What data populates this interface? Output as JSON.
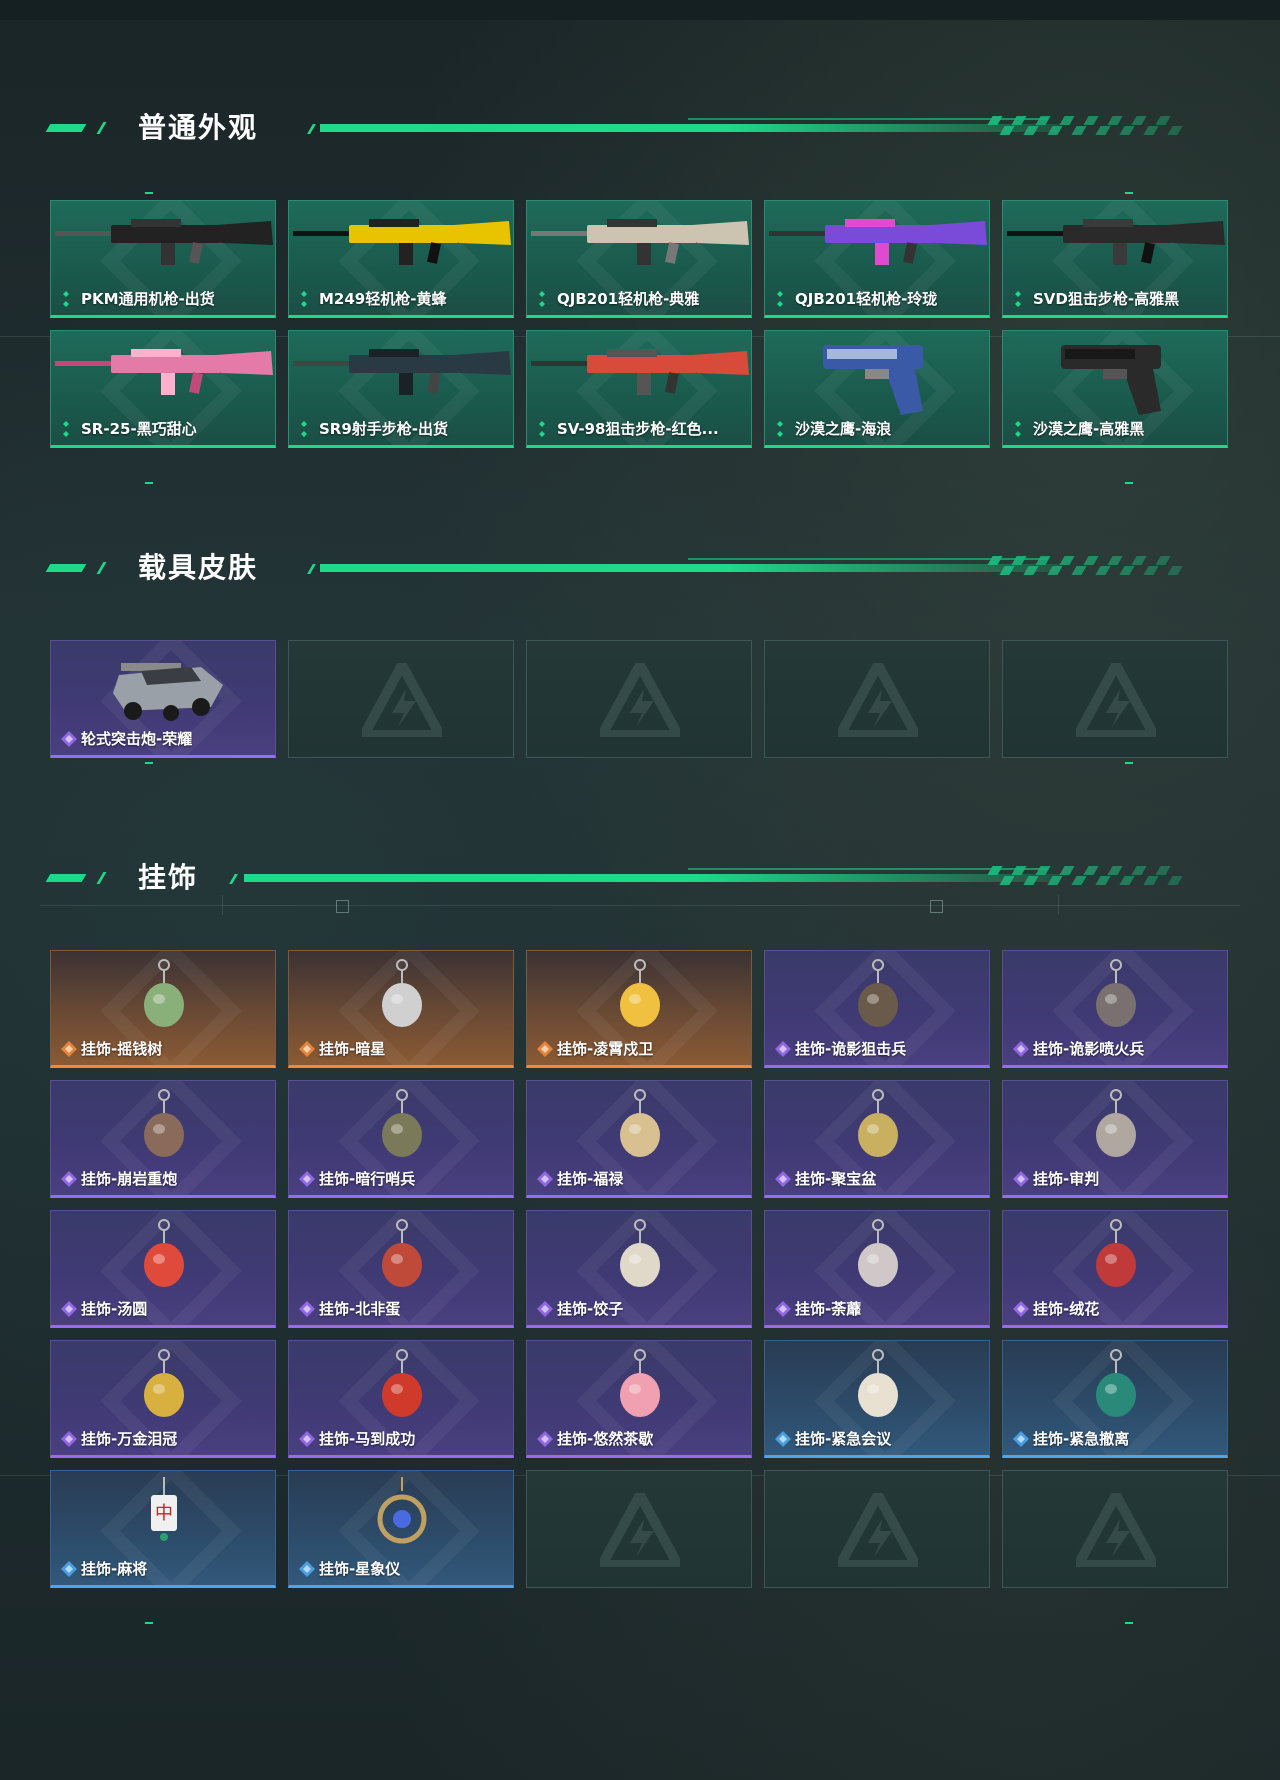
{
  "sections": [
    {
      "title": "普通外观",
      "items": [
        {
          "name": "PKM通用机枪-出货",
          "rarity": "green",
          "icon": "machine-gun-icon"
        },
        {
          "name": "M249轻机枪-黄蜂",
          "rarity": "green",
          "icon": "machine-gun-icon"
        },
        {
          "name": "QJB201轻机枪-典雅",
          "rarity": "green",
          "icon": "machine-gun-icon"
        },
        {
          "name": "QJB201轻机枪-玲珑",
          "rarity": "green",
          "icon": "machine-gun-icon"
        },
        {
          "name": "SVD狙击步枪-高雅黑",
          "rarity": "green",
          "icon": "sniper-rifle-icon"
        },
        {
          "name": "SR-25-黑巧甜心",
          "rarity": "green",
          "icon": "rifle-icon"
        },
        {
          "name": "SR9射手步枪-出货",
          "rarity": "green",
          "icon": "rifle-icon"
        },
        {
          "name": "SV-98狙击步枪-红色...",
          "rarity": "green",
          "icon": "sniper-rifle-icon"
        },
        {
          "name": "沙漠之鹰-海浪",
          "rarity": "green",
          "icon": "pistol-icon"
        },
        {
          "name": "沙漠之鹰-高雅黑",
          "rarity": "green",
          "icon": "pistol-icon"
        }
      ],
      "empty_slots": 0
    },
    {
      "title": "载具皮肤",
      "items": [
        {
          "name": "轮式突击炮-荣耀",
          "rarity": "purple",
          "icon": "armored-vehicle-icon"
        }
      ],
      "empty_slots": 4
    },
    {
      "title": "挂饰",
      "items": [
        {
          "name": "挂饰-摇钱树",
          "rarity": "orange",
          "icon": "charm-icon"
        },
        {
          "name": "挂饰-暗星",
          "rarity": "orange",
          "icon": "charm-icon"
        },
        {
          "name": "挂饰-凌霄戍卫",
          "rarity": "orange",
          "icon": "charm-icon"
        },
        {
          "name": "挂饰-诡影狙击兵",
          "rarity": "purple",
          "icon": "charm-icon"
        },
        {
          "name": "挂饰-诡影喷火兵",
          "rarity": "purple",
          "icon": "charm-icon"
        },
        {
          "name": "挂饰-崩岩重炮",
          "rarity": "purple",
          "icon": "charm-icon"
        },
        {
          "name": "挂饰-暗行哨兵",
          "rarity": "purple",
          "icon": "charm-icon"
        },
        {
          "name": "挂饰-福禄",
          "rarity": "purple",
          "icon": "charm-icon"
        },
        {
          "name": "挂饰-聚宝盆",
          "rarity": "purple",
          "icon": "charm-icon"
        },
        {
          "name": "挂饰-审判",
          "rarity": "purple",
          "icon": "charm-icon"
        },
        {
          "name": "挂饰-汤圆",
          "rarity": "purple",
          "icon": "charm-icon"
        },
        {
          "name": "挂饰-北非蛋",
          "rarity": "purple",
          "icon": "charm-icon"
        },
        {
          "name": "挂饰-饺子",
          "rarity": "purple",
          "icon": "charm-icon"
        },
        {
          "name": "挂饰-荼蘼",
          "rarity": "purple",
          "icon": "charm-icon"
        },
        {
          "name": "挂饰-绒花",
          "rarity": "purple",
          "icon": "charm-icon"
        },
        {
          "name": "挂饰-万金泪冠",
          "rarity": "purple",
          "icon": "charm-icon"
        },
        {
          "name": "挂饰-马到成功",
          "rarity": "purple",
          "icon": "charm-icon"
        },
        {
          "name": "挂饰-悠然茶歇",
          "rarity": "purple",
          "icon": "charm-icon"
        },
        {
          "name": "挂饰-紧急会议",
          "rarity": "blue",
          "icon": "charm-icon"
        },
        {
          "name": "挂饰-紧急撤离",
          "rarity": "blue",
          "icon": "charm-icon"
        },
        {
          "name": "挂饰-麻将",
          "rarity": "blue",
          "icon": "mahjong-charm-icon"
        },
        {
          "name": "挂饰-星象仪",
          "rarity": "blue",
          "icon": "astrolabe-charm-icon"
        }
      ],
      "empty_slots": 3
    }
  ],
  "colors": {
    "accent": "#1fd98a",
    "green": "#1fd98a",
    "purple": "#9a6bf0",
    "orange": "#f08a3a",
    "blue": "#4aa6f0"
  }
}
